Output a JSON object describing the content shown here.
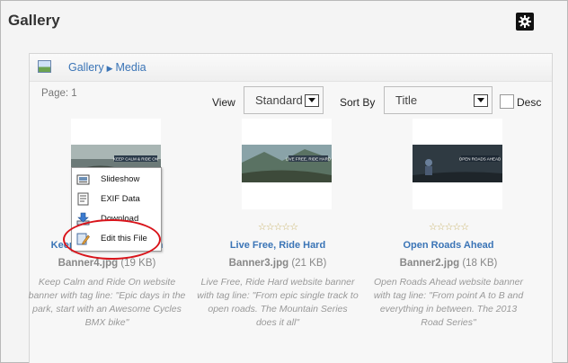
{
  "page": {
    "title": "Gallery"
  },
  "toolbar": {
    "settings_icon": "gear-icon"
  },
  "breadcrumb": {
    "icon": "image-icon",
    "items": [
      "Gallery",
      "Media"
    ]
  },
  "page_info": "Page: 1",
  "controls": {
    "view_label": "View",
    "view_value": "Standard",
    "sort_label": "Sort By",
    "sort_value": "Title",
    "desc_label": "Desc",
    "desc_checked": false
  },
  "items": [
    {
      "title": "Keep Calm and Ride On",
      "file": "Banner4.jpg",
      "size": "(19 KB)",
      "description": "Keep Calm and Ride On website banner with tag line: \"Epic days in the park, start with an Awesome Cycles BMX bike\"",
      "rating": "☆☆☆☆☆",
      "thumb_text": "KEEP CALM & RIDE ON"
    },
    {
      "title": "Live Free, Ride Hard",
      "file": "Banner3.jpg",
      "size": "(21 KB)",
      "description": "Live Free, Ride Hard website banner with tag line: \"From epic single track to open roads. The Mountain Series does it all\"",
      "rating": "☆☆☆☆☆",
      "thumb_text": "LIVE FREE, RIDE HARD"
    },
    {
      "title": "Open Roads Ahead",
      "file": "Banner2.jpg",
      "size": "(18 KB)",
      "description": "Open Roads Ahead website banner with tag line: \"From point A to B and everything in between. The 2013 Road Series\"",
      "rating": "☆☆☆☆☆",
      "thumb_text": "OPEN ROADS AHEAD"
    }
  ],
  "context_menu": {
    "items": [
      {
        "label": "Slideshow",
        "icon": "slideshow-icon"
      },
      {
        "label": "EXIF Data",
        "icon": "exif-data-icon"
      },
      {
        "label": "Download",
        "icon": "download-icon"
      },
      {
        "label": "Edit this File",
        "icon": "edit-file-icon"
      }
    ],
    "highlight_color": "#d9141b"
  },
  "colors": {
    "link": "#3a74b6",
    "muted": "#999999",
    "highlight": "#d9141b"
  }
}
